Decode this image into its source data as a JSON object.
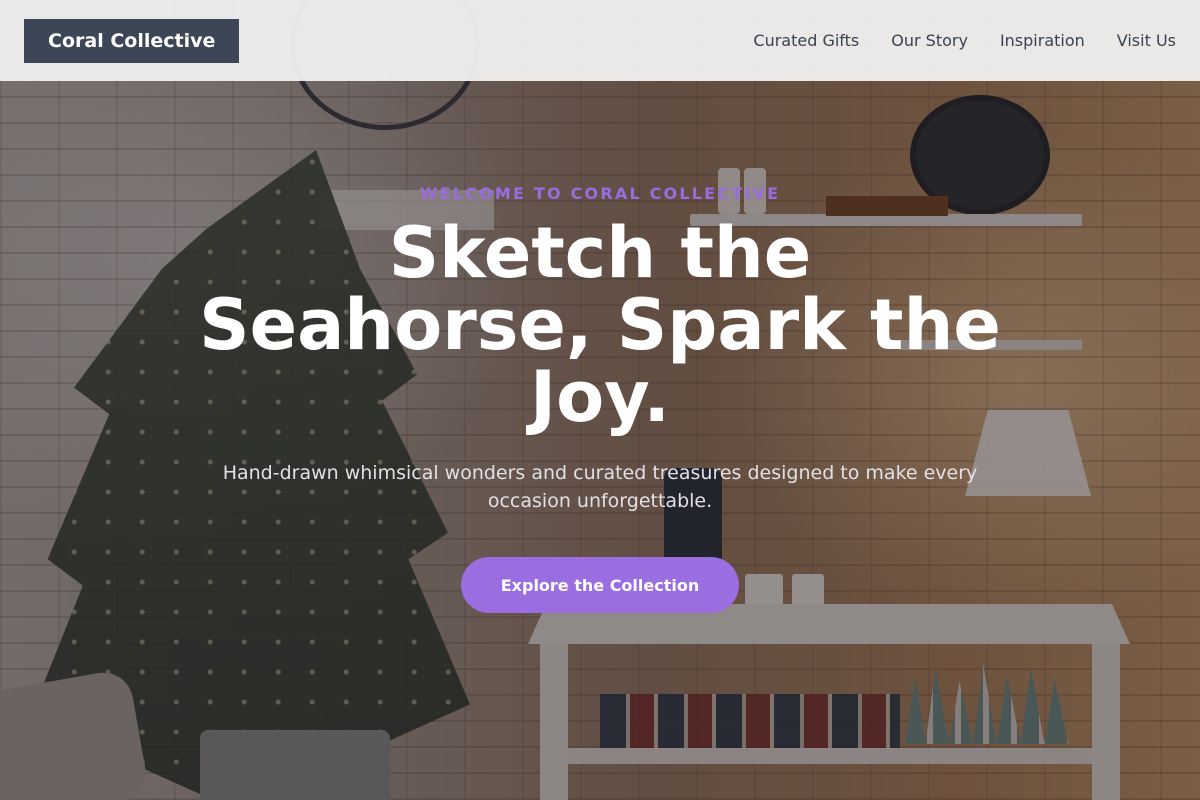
{
  "header": {
    "logo_text": "Coral Collective",
    "nav": [
      {
        "label": "Curated Gifts"
      },
      {
        "label": "Our Story"
      },
      {
        "label": "Inspiration"
      },
      {
        "label": "Visit Us"
      }
    ]
  },
  "hero": {
    "eyebrow": "WELCOME TO CORAL COLLECTIVE",
    "headline": "Sketch the Seahorse, Spark the Joy.",
    "subtext": "Hand-drawn whimsical wonders and curated treasures designed to make every occasion unforgettable.",
    "cta_label": "Explore the Collection"
  },
  "colors": {
    "accent": "#9a6ee0",
    "logo_bg": "#3d4656",
    "header_bg": "#f2f2f2"
  }
}
